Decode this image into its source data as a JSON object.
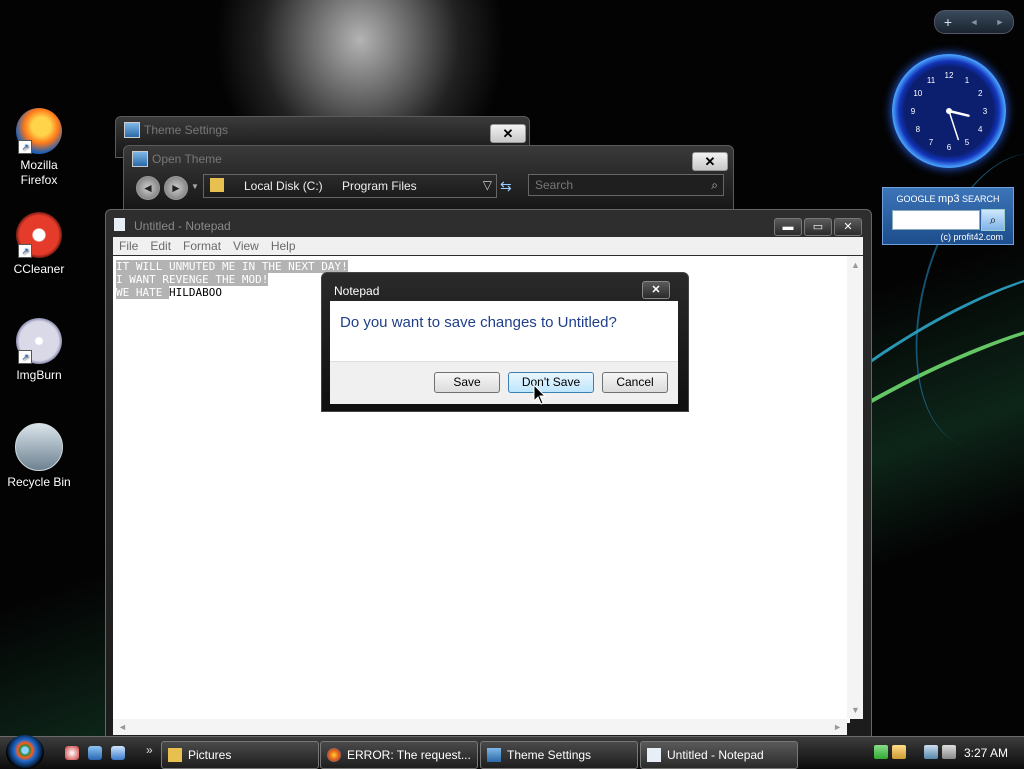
{
  "desktop": {
    "icons": [
      {
        "label_line1": "Mozilla",
        "label_line2": "Firefox",
        "icon": "firefox-icon"
      },
      {
        "label_line1": "CCleaner",
        "label_line2": "",
        "icon": "ccleaner-icon"
      },
      {
        "label_line1": "ImgBurn",
        "label_line2": "",
        "icon": "imgburn-icon"
      },
      {
        "label_line1": "Recycle Bin",
        "label_line2": "",
        "icon": "recycle-bin-icon"
      }
    ]
  },
  "sidebar": {
    "add": "+",
    "prev": "◄",
    "next": "►"
  },
  "clock_gadget": {
    "hours": [
      "12",
      "1",
      "2",
      "3",
      "4",
      "5",
      "6",
      "7",
      "8",
      "9",
      "10",
      "11"
    ],
    "hour": 3,
    "minute": 27
  },
  "google_gadget": {
    "title_small": "GOOGLE",
    "title_big": "mp3",
    "title_rest": "SEARCH",
    "copyright": "(c) profit42.com"
  },
  "theme_settings_window": {
    "title": "Theme Settings",
    "close": "✕"
  },
  "open_theme_window": {
    "title": "Open Theme",
    "close": "✕",
    "address": {
      "segment1": "Local Disk (C:)",
      "segment2": "Program Files"
    },
    "search_placeholder": "Search"
  },
  "notepad": {
    "title": "Untitled - Notepad",
    "menu": [
      "File",
      "Edit",
      "Format",
      "View",
      "Help"
    ],
    "lines": {
      "l1_selected": "IT WILL UNMUTED ME IN THE NEXT DAY!",
      "l2_selected": "I WANT REVENGE THE MOD!",
      "l3_selected": "WE HATE ",
      "l3_rest": "HILDABOO"
    }
  },
  "dialog": {
    "title": "Notepad",
    "close": "✕",
    "message": "Do you want to save changes to Untitled?",
    "buttons": {
      "save": "Save",
      "dont_save": "Don't Save",
      "cancel": "Cancel"
    }
  },
  "taskbar": {
    "tasks": [
      {
        "label": "Pictures",
        "icon": "folder-icon"
      },
      {
        "label": "ERROR: The request...",
        "icon": "firefox-icon"
      },
      {
        "label": "Theme Settings",
        "icon": "theme-icon"
      },
      {
        "label": "Untitled - Notepad",
        "icon": "notepad-icon"
      }
    ],
    "chevron": "»",
    "time": "3:27 AM"
  },
  "colors": {
    "dialog_text": "#1f3f8a",
    "selection": "#b3b3b3",
    "focus_button": "#3c7fb1"
  }
}
